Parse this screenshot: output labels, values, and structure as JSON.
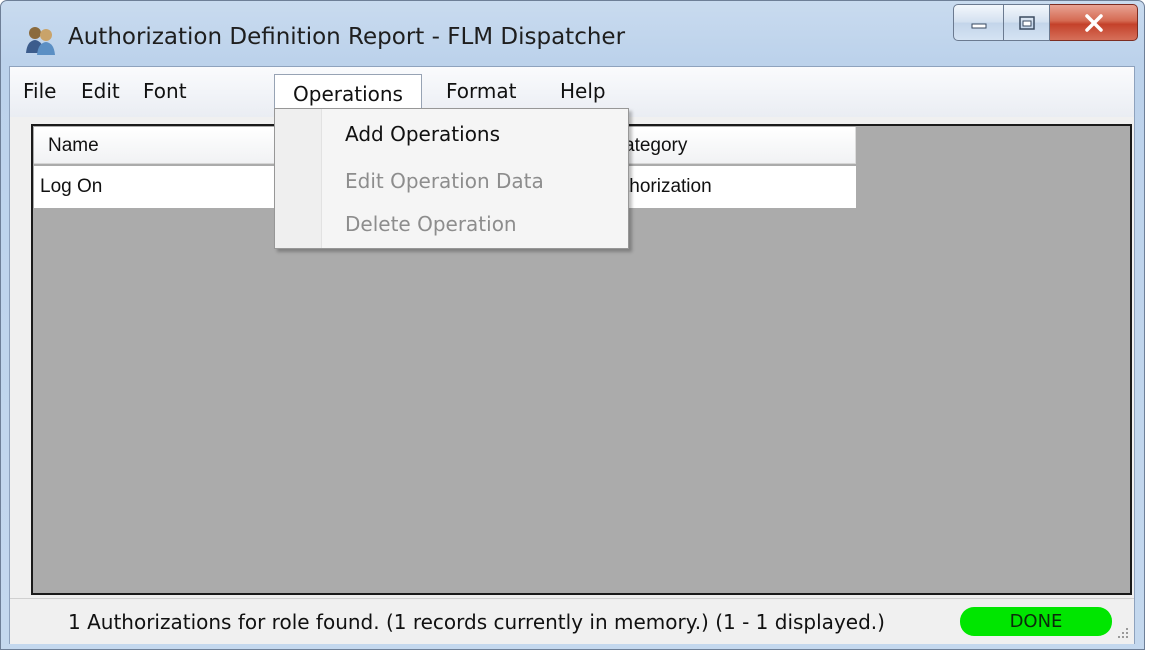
{
  "window": {
    "title": "Authorization Definition Report - FLM Dispatcher",
    "icons": {
      "app": "users-icon",
      "minimize": "minimize-icon",
      "maximize": "maximize-icon",
      "close": "close-icon"
    }
  },
  "menubar": {
    "items": [
      {
        "label": "File"
      },
      {
        "label": "Edit"
      },
      {
        "label": "Font"
      },
      {
        "label": "Operations",
        "open": true
      },
      {
        "label": "Format"
      },
      {
        "label": "Help"
      }
    ]
  },
  "operations_menu": {
    "items": [
      {
        "label": "Add Operations",
        "enabled": true
      },
      {
        "label": "Edit Operation Data",
        "enabled": false
      },
      {
        "label": "Delete Operation",
        "enabled": false
      }
    ]
  },
  "grid": {
    "columns": [
      {
        "label": "Name"
      },
      {
        "label": "ategory"
      }
    ],
    "rows": [
      {
        "name": "Log On",
        "category": "thorization"
      }
    ]
  },
  "statusbar": {
    "message": "1 Authorizations for role found.  (1 records currently in memory.)  (1 - 1 displayed.)",
    "state": "DONE",
    "state_color": "#00e600"
  }
}
